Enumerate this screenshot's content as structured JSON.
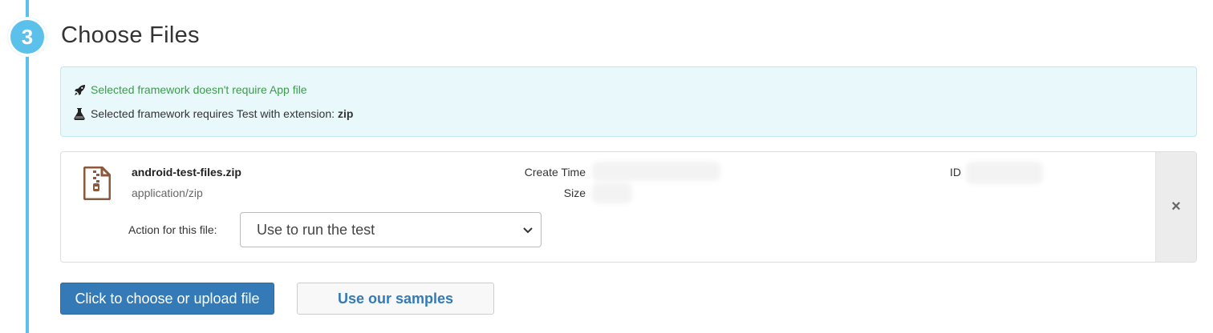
{
  "step": {
    "number": "3",
    "title": "Choose Files"
  },
  "info": {
    "app_message": "Selected framework doesn't require App file",
    "test_message": "Selected framework requires Test with extension:",
    "test_extension": "zip",
    "icons": [
      "rocket-icon",
      "flask-icon"
    ]
  },
  "file": {
    "name": "android-test-files.zip",
    "type": "application/zip",
    "create_time_label": "Create Time",
    "size_label": "Size",
    "id_label": "ID",
    "action_label": "Action for this file:",
    "action_selected": "Use to run the test",
    "remove_symbol": "×",
    "icon": "zip-file-icon"
  },
  "buttons": {
    "upload_label": "Click to choose or upload file",
    "samples_label": "Use our samples"
  },
  "colors": {
    "accent": "#5bc0ea",
    "primary": "#337ab7",
    "success_text": "#3c9c4a",
    "info_bg": "#e8f8fb",
    "file_icon": "#8b5a3c"
  }
}
